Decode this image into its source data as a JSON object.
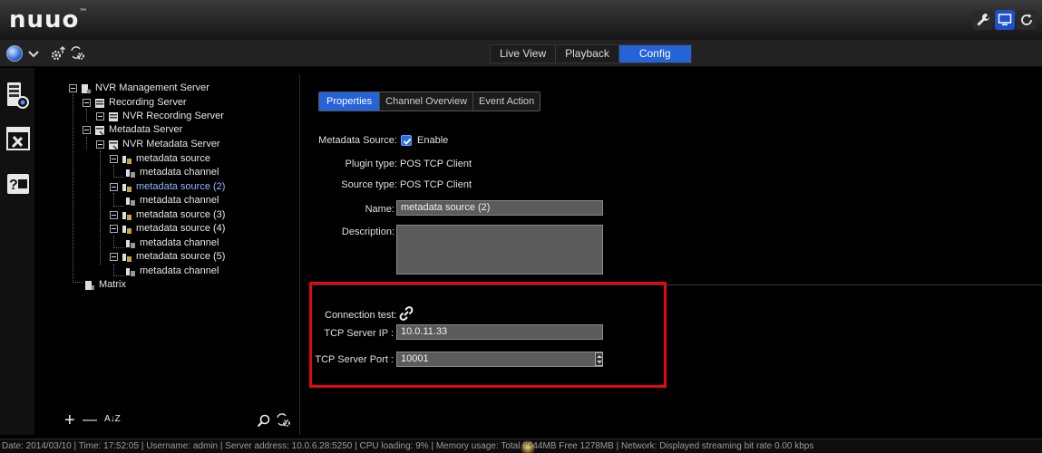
{
  "header": {
    "logo": "nuuo",
    "trademark": "™",
    "buttons": [
      {
        "icon": "wrench-icon"
      },
      {
        "icon": "monitor-icon"
      },
      {
        "icon": "refresh-icon"
      }
    ]
  },
  "toolbar": {
    "icons": [
      "globe-icon",
      "chevron-down-icon",
      "gear-upload-icon",
      "gear-sync-icon"
    ]
  },
  "main_tabs": [
    "Live View",
    "Playback",
    "Config"
  ],
  "active_main_tab": "Config",
  "rail_icons": [
    "server-icon",
    "tools-window-icon",
    "help-wallet-icon"
  ],
  "tree": {
    "root": "NVR Management Server",
    "recording_server": "Recording Server",
    "nvr_recording_server": "NVR Recording Server",
    "metadata_server": "Metadata Server",
    "nvr_metadata_server": "NVR Metadata Server",
    "ms1": "metadata source",
    "mc1": "metadata channel",
    "ms2": "metadata source (2)",
    "mc2": "metadata channel",
    "ms3": "metadata source (3)",
    "ms4": "metadata source (4)",
    "mc4": "metadata channel",
    "ms5": "metadata source (5)",
    "mc5": "metadata channel",
    "matrix": "Matrix",
    "selected": "metadata source (2)"
  },
  "tree_tools": {
    "add": "+",
    "remove": "—",
    "sort": "A↓Z",
    "search_icon": "search-icon",
    "sync_icon": "gear-sync-icon"
  },
  "sub_tabs": [
    "Properties",
    "Channel Overview",
    "Event Action"
  ],
  "active_sub_tab": "Properties",
  "properties": {
    "metadata_source_label": "Metadata Source:",
    "enable_label": "Enable",
    "enable_checked": true,
    "plugin_type_label": "Plugin type:",
    "plugin_type_value": "POS TCP Client",
    "source_type_label": "Source type:",
    "source_type_value": "POS TCP Client",
    "name_label": "Name:",
    "name_value": "metadata source (2)",
    "description_label": "Description:",
    "description_value": ""
  },
  "connection": {
    "test_label": "Connection test:",
    "test_icon": "link-icon",
    "ip_label": "TCP Server IP :",
    "ip_value": "10.0.11.33",
    "port_label": "TCP Server Port :",
    "port_value": "10001"
  },
  "status": "Date: 2014/03/10  |  Time: 17:52:05  |  Username: admin  |  Server address: 10.0.6.28:5250  |  CPU loading: 9%  |  Memory usage: Total 6044MB  Free 1278MB  |  Network: Displayed streaming bit rate    0.00 kbps",
  "colors": {
    "accent": "#2563d8",
    "highlight": "#e30613",
    "field_bg": "#5b5b5b",
    "background": "#000000"
  }
}
